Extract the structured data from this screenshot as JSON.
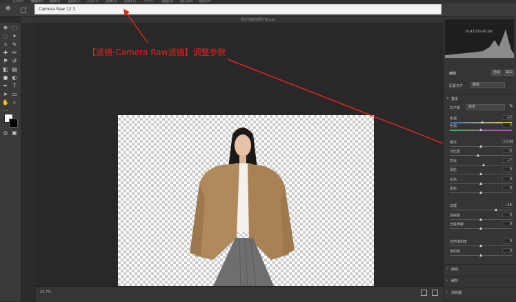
{
  "menu": [
    "文件(F)",
    "编辑(E)",
    "图像(I)",
    "图层(L)",
    "文字(Y)",
    "选择(S)",
    "滤镜(T)",
    "3D(D)",
    "视图(V)",
    "窗口(W)",
    "帮助(H)"
  ],
  "title": "Camera Raw 12.3",
  "document_title": "清冷忧郁拍照片套.psd",
  "annotation": "【滤镜-Camera Raw滤镜】调整参数",
  "zoom": "24.7%",
  "histogram_readout": "f/1.8   1/125   ISO 100",
  "panel": {
    "tab_edit": "编辑",
    "btn_auto": "自动",
    "btn_bw": "黑白",
    "profile_label": "配置文件",
    "profile_value": "颜色",
    "section_basic": "基本",
    "wb_label": "白平衡",
    "wb_value": "自定",
    "sliders": [
      {
        "label": "色温",
        "value": "+2",
        "pos": 0.52
      },
      {
        "label": "色调",
        "value": "0",
        "pos": 0.5
      },
      {
        "label": "曝光",
        "value": "+0.00",
        "pos": 0.5
      },
      {
        "label": "对比度",
        "value": "-8",
        "pos": 0.46
      },
      {
        "label": "高光",
        "value": "+7",
        "pos": 0.54
      },
      {
        "label": "阴影",
        "value": "0",
        "pos": 0.5
      },
      {
        "label": "白色",
        "value": "0",
        "pos": 0.5
      },
      {
        "label": "黑色",
        "value": "0",
        "pos": 0.5
      },
      {
        "label": "纹理",
        "value": "+48",
        "pos": 0.74
      },
      {
        "label": "清晰度",
        "value": "0",
        "pos": 0.5
      },
      {
        "label": "去除薄雾",
        "value": "0",
        "pos": 0.5
      },
      {
        "label": "自然饱和度",
        "value": "0",
        "pos": 0.5
      },
      {
        "label": "饱和度",
        "value": "0",
        "pos": 0.5
      }
    ],
    "sections": [
      "曲线",
      "细节",
      "混色器"
    ]
  },
  "colors": {
    "annotation": "#e0261c",
    "jacket": "#b08a5c",
    "skirt": "#6e6e6e"
  }
}
